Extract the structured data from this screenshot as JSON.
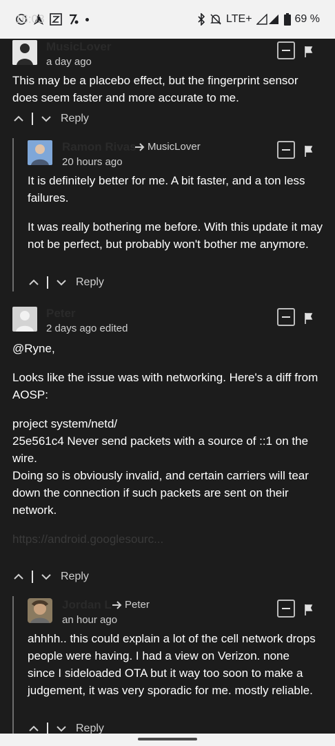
{
  "status_bar": {
    "time": "16:03",
    "network": "LTE+",
    "battery": "69 %",
    "icons": [
      "whatsapp-icon",
      "navigation-icon",
      "z-app-icon",
      "percent-app-icon",
      "bluetooth-icon",
      "mute-icon",
      "signal-icon",
      "battery-icon"
    ]
  },
  "comments": [
    {
      "author": "MusicLover",
      "time": "a day ago",
      "body": [
        "This may be a placebo effect, but the fingerprint sensor does seem faster and more accurate to me."
      ],
      "reply_label": "Reply"
    },
    {
      "author": "Ramon Rivas",
      "reply_to": "MusicLover",
      "time": "20 hours ago",
      "body": [
        "It is definitely better for me. A bit faster, and a ton less failures.",
        "It was really bothering me before. With this update it may not be perfect, but probably won't bother me anymore."
      ],
      "reply_label": "Reply"
    },
    {
      "author": "Peter",
      "time": "2 days ago edited",
      "body": [
        "@Ryne,",
        "Looks like the issue was with networking. Here's a diff from AOSP:",
        "project system/netd/\n25e561c4 Never send packets with a source of ::1 on the wire.\nDoing so is obviously invalid, and certain carriers will tear\ndown the connection if such packets are sent on their network."
      ],
      "link": "https://android.googlesourc...",
      "reply_label": "Reply"
    },
    {
      "author": "Jordan L",
      "reply_to": "Peter",
      "time": "an hour ago",
      "body": [
        "ahhhh.. this could explain a lot of the cell network drops people were having. I had a view on Verizon. none since I sideloaded OTA but it way too soon to make a judgement, it was very sporadic for me. mostly reliable."
      ],
      "reply_label": "Reply"
    }
  ]
}
